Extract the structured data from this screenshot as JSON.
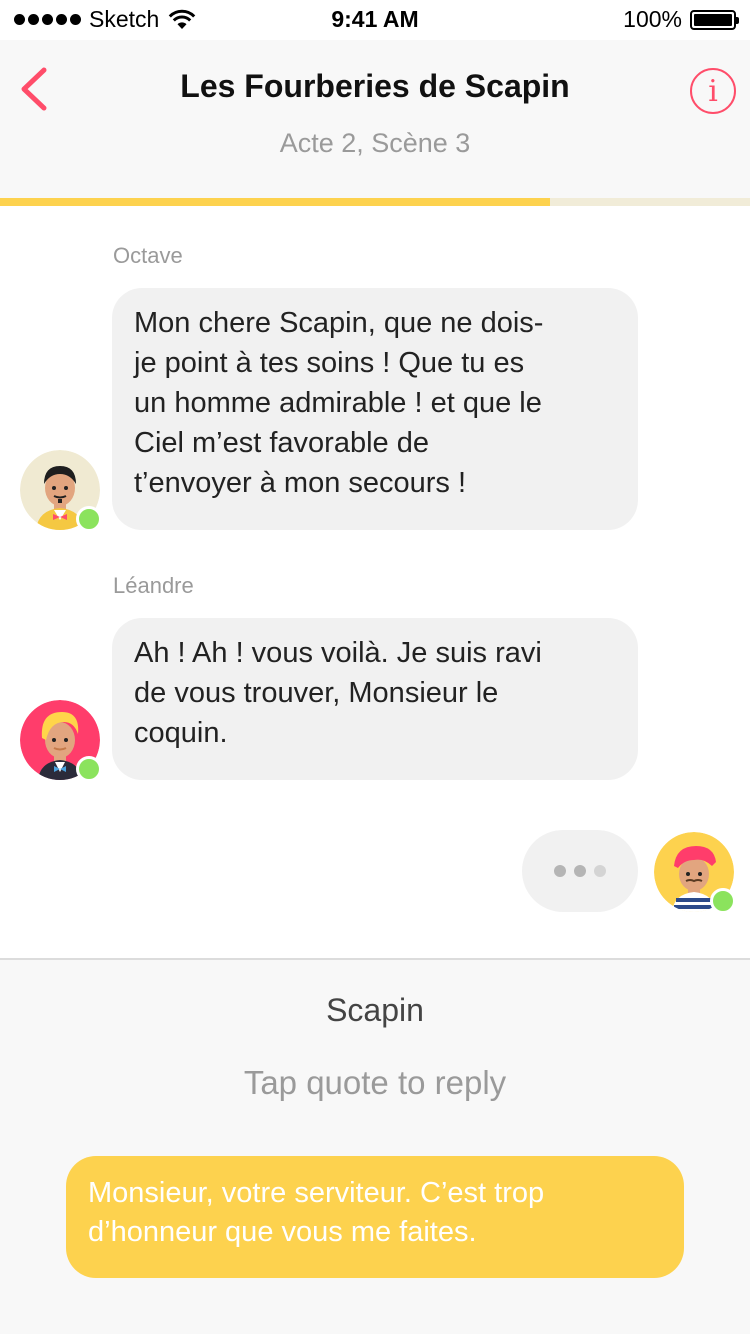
{
  "status_bar": {
    "carrier": "Sketch",
    "time": "9:41 AM",
    "battery": "100%"
  },
  "header": {
    "title": "Les Fourberies de Scapin",
    "subtitle": "Acte 2, Scène 3",
    "progress": 0.733,
    "icons": {
      "back": "chevron-left-icon",
      "info": "info-icon"
    }
  },
  "messages": [
    {
      "speaker": "Octave",
      "lines": [
        "Mon chere Scapin, que ne dois-",
        "je point à tes soins ! Que tu es",
        "un homme admirable ! et que le",
        "Ciel m’est favorable de",
        "t’envoyer à mon secours !"
      ]
    },
    {
      "speaker": "Léandre",
      "lines": [
        "Ah ! Ah ! vous voilà. Je suis ravi",
        "de vous trouver, Monsieur le",
        "coquin."
      ]
    }
  ],
  "reply": {
    "character": "Scapin",
    "hint": "Tap quote to reply",
    "quote_lines": [
      "Monsieur, votre serviteur. C’est trop",
      "d’honneur que vous me faites."
    ]
  },
  "colors": {
    "accent": "#ff4d6a",
    "progress": "#fdd24e",
    "online": "#8be35d",
    "bubble": "#f1f1f1"
  }
}
